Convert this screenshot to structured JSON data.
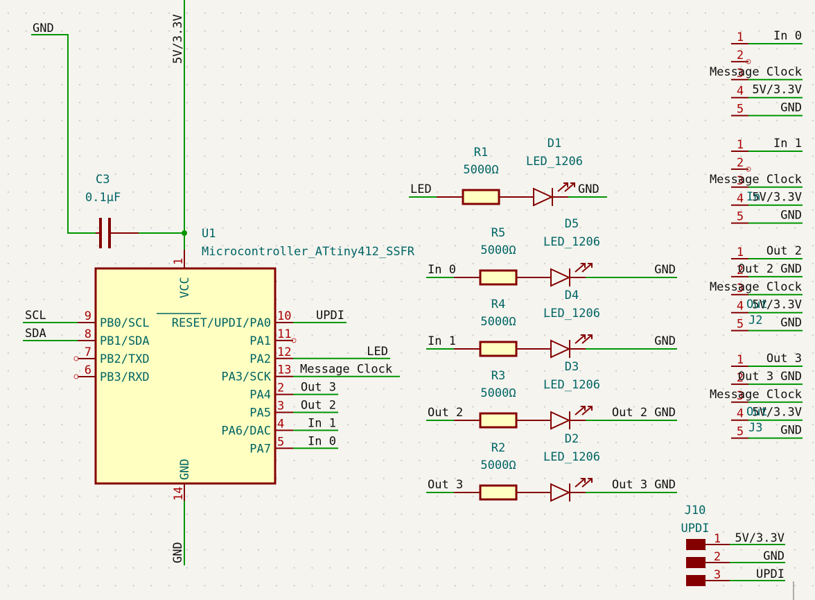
{
  "colors": {
    "wire": "#009600",
    "pin": "#840000",
    "body_fill": "#ffffc2",
    "ref_text": "#006464",
    "pin_number": "#a90000",
    "background": "#f5f4ef"
  },
  "power": {
    "gnd_top": "GND",
    "vcc_rail": "5V/3.3V",
    "gnd_bottom": "GND"
  },
  "capacitor": {
    "ref": "C3",
    "value": "0.1µF"
  },
  "mcu": {
    "ref": "U1",
    "value": "Microcontroller_ATtiny412_SSFR",
    "vcc_pin": {
      "num": "1",
      "name": "VCC"
    },
    "gnd_pin": {
      "num": "14",
      "name": "GND"
    },
    "left_pins": [
      {
        "num": "9",
        "name": "PB0/SCL",
        "net": "SCL"
      },
      {
        "num": "8",
        "name": "PB1/SDA",
        "net": "SDA"
      },
      {
        "num": "7",
        "name": "PB2/TXD",
        "net": ""
      },
      {
        "num": "6",
        "name": "PB3/RXD",
        "net": ""
      }
    ],
    "right_pins": [
      {
        "num": "10",
        "name": "RESET/UPDI/PA0",
        "net": "UPDI"
      },
      {
        "num": "11",
        "name": "PA1",
        "net": ""
      },
      {
        "num": "12",
        "name": "PA2",
        "net": "LED"
      },
      {
        "num": "13",
        "name": "PA3/SCK",
        "net": "Message Clock"
      },
      {
        "num": "2",
        "name": "PA4",
        "net": "Out 3"
      },
      {
        "num": "3",
        "name": "PA5",
        "net": "Out 2"
      },
      {
        "num": "4",
        "name": "PA6/DAC",
        "net": "In 1"
      },
      {
        "num": "5",
        "name": "PA7",
        "net": "In 0"
      }
    ]
  },
  "led_rows": [
    {
      "res_ref": "R1",
      "res_value": "5000Ω",
      "led_ref": "D1",
      "led_value": "LED_1206",
      "in_net": "LED",
      "out_net": "GND"
    },
    {
      "res_ref": "R5",
      "res_value": "5000Ω",
      "led_ref": "D5",
      "led_value": "LED_1206",
      "in_net": "In 0",
      "out_net": "GND"
    },
    {
      "res_ref": "R4",
      "res_value": "5000Ω",
      "led_ref": "D4",
      "led_value": "LED_1206",
      "in_net": "In 1",
      "out_net": "GND"
    },
    {
      "res_ref": "R3",
      "res_value": "5000Ω",
      "led_ref": "D3",
      "led_value": "LED_1206",
      "in_net": "Out 2",
      "out_net": "Out 2 GND"
    },
    {
      "res_ref": "R2",
      "res_value": "5000Ω",
      "led_ref": "D2",
      "led_value": "LED_1206",
      "in_net": "Out 3",
      "out_net": "Out 3 GND"
    }
  ],
  "connectors": [
    {
      "ref": "",
      "value": "",
      "pins": [
        {
          "num": "1",
          "net": "In 0"
        },
        {
          "num": "2",
          "net": ""
        },
        {
          "num": "3",
          "net": "Message Clock"
        },
        {
          "num": "4",
          "net": "5V/3.3V"
        },
        {
          "num": "5",
          "net": "GND"
        }
      ]
    },
    {
      "ref": "",
      "value": "In",
      "pins": [
        {
          "num": "1",
          "net": "In 1"
        },
        {
          "num": "2",
          "net": ""
        },
        {
          "num": "3",
          "net": "Message Clock"
        },
        {
          "num": "4",
          "net": "5V/3.3V"
        },
        {
          "num": "5",
          "net": "GND"
        }
      ]
    },
    {
      "ref": "J2",
      "value": "Out",
      "pins": [
        {
          "num": "1",
          "net": "Out 2"
        },
        {
          "num": "2",
          "net": "Out 2 GND"
        },
        {
          "num": "3",
          "net": "Message Clock"
        },
        {
          "num": "4",
          "net": "5V/3.3V"
        },
        {
          "num": "5",
          "net": "GND"
        }
      ]
    },
    {
      "ref": "J3",
      "value": "Out",
      "pins": [
        {
          "num": "1",
          "net": "Out 3"
        },
        {
          "num": "2",
          "net": "Out 3 GND"
        },
        {
          "num": "3",
          "net": "Message Clock"
        },
        {
          "num": "4",
          "net": "5V/3.3V"
        },
        {
          "num": "5",
          "net": "GND"
        }
      ]
    }
  ],
  "updi_header": {
    "ref": "J10",
    "value": "UPDI",
    "pins": [
      {
        "num": "1",
        "net": "5V/3.3V"
      },
      {
        "num": "2",
        "net": "GND"
      },
      {
        "num": "3",
        "net": "UPDI"
      }
    ]
  }
}
